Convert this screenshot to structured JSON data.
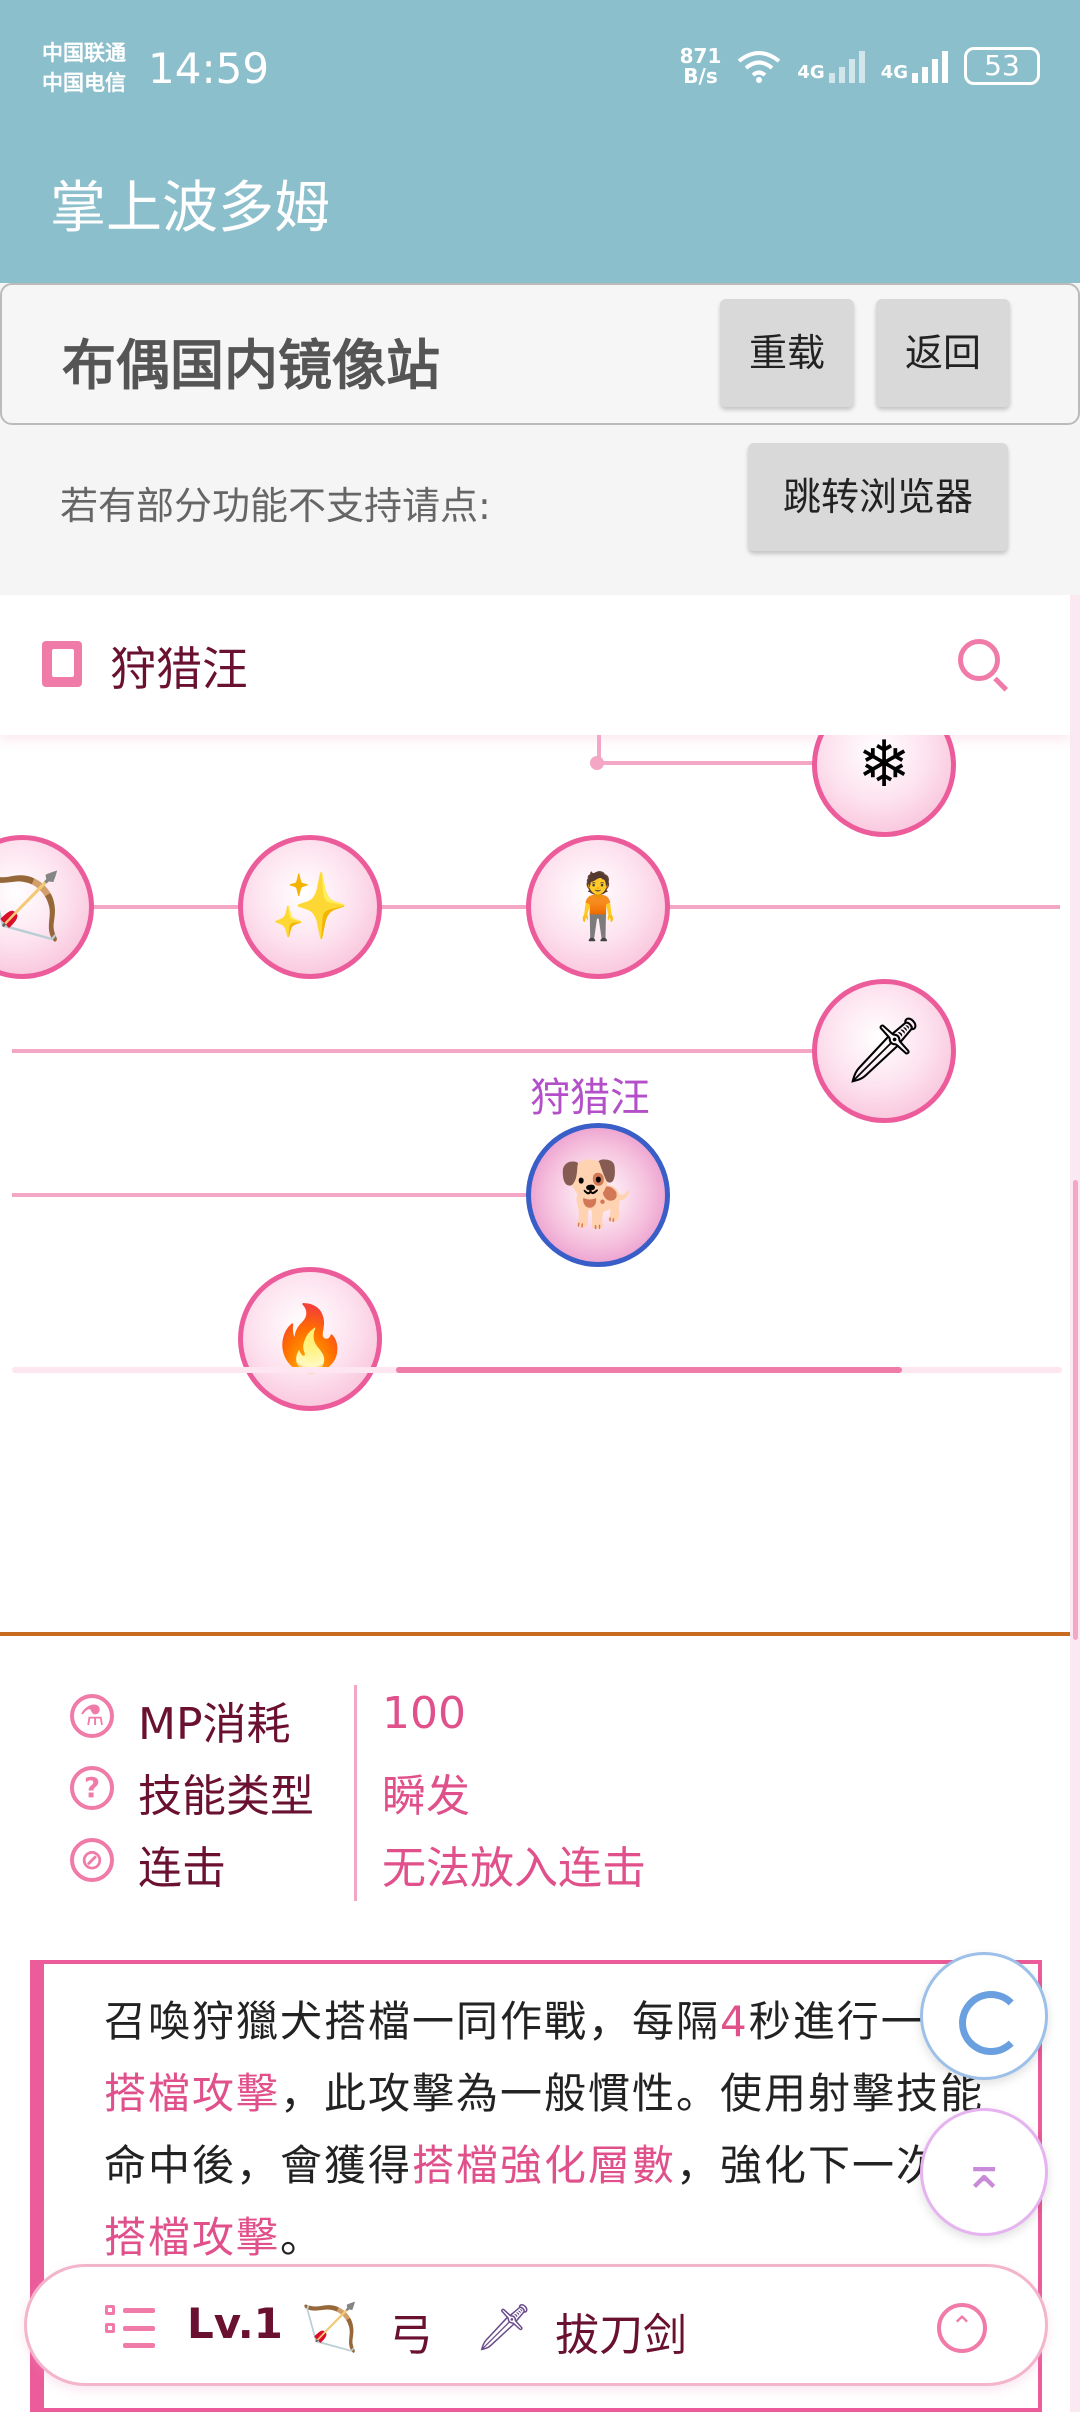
{
  "status_bar": {
    "carrier_1": "中国联通",
    "carrier_2": "中国电信",
    "time": "14:59",
    "net_rate_value": "871",
    "net_rate_unit": "B/s",
    "signal_1_type": "4G",
    "signal_2_type": "4G",
    "battery": "53"
  },
  "app": {
    "title": "掌上波多姆"
  },
  "mirror": {
    "title": "布偶国内镜像站",
    "reload_label": "重载",
    "back_label": "返回",
    "hint": "若有部分功能不支持请点:",
    "open_browser_label": "跳转浏览器"
  },
  "header": {
    "title": "狩猎汪",
    "book_icon": "book-icon",
    "search_icon": "search-icon"
  },
  "skill_tree": {
    "selected_label": "狩猎汪",
    "nodes": [
      {
        "name": "ice-arrows-skill",
        "icon": "❄"
      },
      {
        "name": "bow-arrow-skill",
        "icon": "🏹"
      },
      {
        "name": "sparkle-arrow-skill",
        "icon": "✨"
      },
      {
        "name": "partner-figures-skill",
        "icon": "🧍"
      },
      {
        "name": "bow-sword-skill",
        "icon": "🗡"
      },
      {
        "name": "hunting-dog-skill",
        "icon": "🐕"
      },
      {
        "name": "fire-arrow-skill",
        "icon": "🔥"
      }
    ]
  },
  "info": {
    "rows": [
      {
        "icon": "potion-icon",
        "glyph": "⚗",
        "label": "MP消耗",
        "value": "100"
      },
      {
        "icon": "question-icon",
        "glyph": "?",
        "label": "技能类型",
        "value": "瞬发"
      },
      {
        "icon": "prohibited-icon",
        "glyph": "⊘",
        "label": "连击",
        "value": "无法放入连击"
      }
    ]
  },
  "description": {
    "p1": "召喚狩獵犬搭檔一同作戰，每隔",
    "n1": "4",
    "p2": "秒進行一次",
    "h1": "搭檔攻擊",
    "p3": "，此攻擊為一般慣性。使用射擊技能命中後，會獲得",
    "h2": "搭檔強化層數",
    "p4": "，強化下一次的",
    "h3": "搭檔攻擊",
    "p5": "。"
  },
  "bottom_bar": {
    "level": "Lv.1",
    "weapon_1": "弓",
    "weapon_1_icon": "bow-icon",
    "weapon_2": "拔刀剑",
    "weapon_2_icon": "katana-icon"
  },
  "colors": {
    "appbar": "#8cbfcc",
    "accent_pink": "#f07aa8",
    "text_maroon": "#6a1030",
    "divider_orange": "#c96b1e",
    "selected_ring": "#3a5ec8"
  }
}
